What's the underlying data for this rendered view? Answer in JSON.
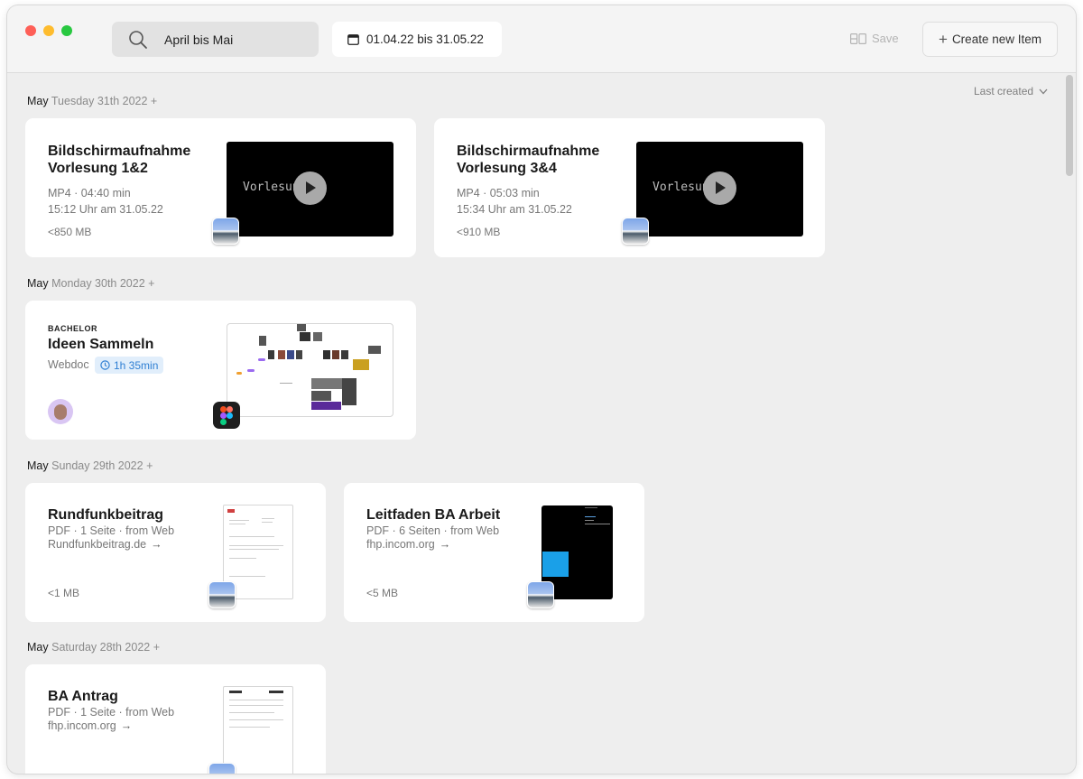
{
  "toolbar": {
    "search_value": "April bis Mai",
    "date_range": "01.04.22 bis 31.05.22",
    "save_label": "Save",
    "create_label": "Create new Item"
  },
  "sort": {
    "label": "Last created"
  },
  "groups": [
    {
      "month": "May",
      "day": "Tuesday 31th 2022",
      "plus": "+"
    },
    {
      "month": "May",
      "day": "Monday 30th 2022",
      "plus": "+"
    },
    {
      "month": "May",
      "day": "Sunday 29th 2022",
      "plus": "+"
    },
    {
      "month": "May",
      "day": "Saturday 28th 2022",
      "plus": "+"
    }
  ],
  "cards": {
    "vid1": {
      "title1": "Bildschirmaufnahme",
      "title2": "Vorlesung 1&2",
      "meta1": "MP4 · 04:40 min",
      "meta2": "15:12 Uhr am 31.05.22",
      "size": "<850 MB",
      "thumb_text": "Vorlesung"
    },
    "vid2": {
      "title1": "Bildschirmaufnahme",
      "title2": "Vorlesung 3&4",
      "meta1": "MP4 · 05:03 min",
      "meta2": "15:34 Uhr am 31.05.22",
      "size": "<910 MB",
      "thumb_text": "Vorlesung"
    },
    "webdoc": {
      "tag": "BACHELOR",
      "title": "Ideen Sammeln",
      "type": "Webdoc",
      "duration": "1h 35min"
    },
    "pdf1": {
      "title": "Rundfunkbeitrag",
      "meta1": "PDF · 1 Seite · from Web",
      "link": "Rundfunkbeitrag.de",
      "size": "<1 MB"
    },
    "pdf2": {
      "title": "Leitfaden BA Arbeit",
      "meta1": "PDF · 6 Seiten · from Web",
      "link": "fhp.incom.org",
      "size": "<5 MB"
    },
    "pdf3": {
      "title": "BA Antrag",
      "meta1": "PDF · 1 Seite · from Web",
      "link": "fhp.incom.org"
    }
  },
  "icons": {
    "search": "search-icon",
    "calendar": "calendar-icon",
    "save": "save-layout-icon",
    "create": "plus-icon",
    "sort": "chevron-down-icon",
    "play": "play-icon",
    "figma": "figma-icon",
    "clock": "clock-icon",
    "arrow": "arrow-right-icon"
  },
  "colors": {
    "accent": "#2f7fd3",
    "badge_bg": "#e1eefb",
    "close": "#fe5f57",
    "minimize": "#febc2e",
    "zoom": "#28c840"
  }
}
